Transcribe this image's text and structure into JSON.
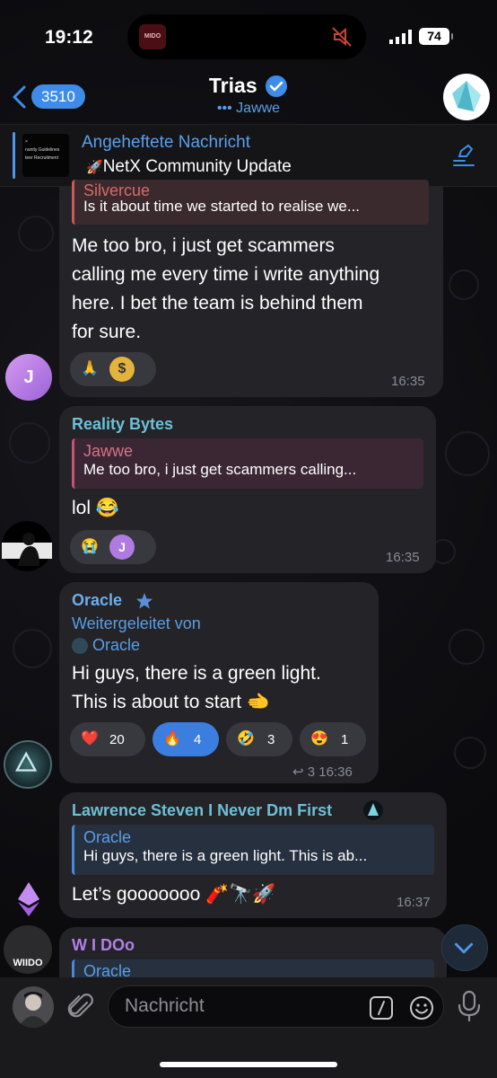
{
  "status_bar": {
    "time": "19:12",
    "battery": "74",
    "island_thumb": "MIDO"
  },
  "header": {
    "back_count": "3510",
    "title": "Trias",
    "subtitle": "Jawwe"
  },
  "pinned": {
    "title": "Angeheftete Nachricht",
    "text": "NetX Community Update",
    "thumb_lines": [
      "×",
      "nunity Guidelines",
      "teer Recruitment"
    ]
  },
  "messages": [
    {
      "reply_name": "Silvercue",
      "reply_text": "Is it about time we started to realise we...",
      "lines": [
        "Me too bro, i just get scammers",
        "calling me every time i write anything",
        "here. I bet the team is behind them",
        "for sure."
      ],
      "time": "16:35",
      "avatar_letter": "J"
    },
    {
      "sender": "Reality Bytes",
      "reply_name": "Jawwe",
      "reply_text": "Me too bro, i just get scammers calling...",
      "text": "lol 😂",
      "time": "16:35",
      "reaction_letter": "J"
    },
    {
      "sender": "Oracle",
      "forwarded_label": "Weitergeleitet von",
      "forwarded_name": "Oracle",
      "lines": [
        "Hi guys, there is a green light.",
        "This is about to start 🫲"
      ],
      "reactions": [
        {
          "emoji": "❤️",
          "count": "20"
        },
        {
          "emoji": "🔥",
          "count": "4"
        },
        {
          "emoji": "🤣",
          "count": "3"
        },
        {
          "emoji": "😍",
          "count": "1"
        }
      ],
      "replies": "3",
      "time": "16:36"
    },
    {
      "sender": "Lawrence Steven I Never Dm First",
      "reply_name": "Oracle",
      "reply_text": "Hi guys, there is a green light. This is ab...",
      "text": "Let’s gooooooo 🧨🔭🚀",
      "time": "16:37"
    },
    {
      "sender": "W I DOo",
      "reply_name": "Oracle",
      "avatar_text": "WIIDO"
    }
  ],
  "input": {
    "placeholder": "Nachricht"
  },
  "colors": {
    "accent": "#3e8ce8",
    "bubble": "#232328",
    "background": "#0b0b0e"
  }
}
